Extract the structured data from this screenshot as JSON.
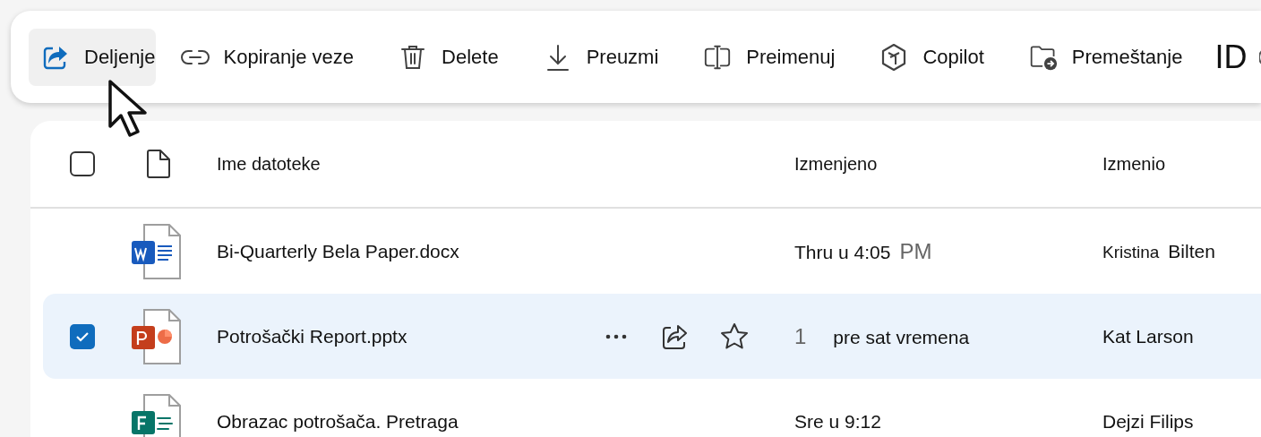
{
  "toolbar": {
    "items": [
      {
        "kind": "share",
        "label": "Deljenje",
        "hovered": true
      },
      {
        "kind": "link",
        "label": "Kopiranje veze",
        "hovered": false
      },
      {
        "kind": "delete",
        "label": "Delete",
        "hovered": false
      },
      {
        "kind": "download",
        "label": "Preuzmi",
        "hovered": false
      },
      {
        "kind": "rename",
        "label": "Preimenuj",
        "hovered": false
      },
      {
        "kind": "copilot",
        "label": "Copilot",
        "hovered": false
      },
      {
        "kind": "move",
        "label": "Premeštanje",
        "hovered": false
      }
    ],
    "overflow_label": "ID"
  },
  "table": {
    "columns": [
      "Ime datoteke",
      "Izmenjeno",
      "Izmenio"
    ],
    "all_selected": false,
    "rows": [
      {
        "kind": "word",
        "name": "Bi-Quarterly Bela Paper.docx",
        "modified": [
          {
            "text": "Thru u 4:05",
            "dim": false
          },
          {
            "text": "PM",
            "dim": true
          }
        ],
        "modified_by": [
          "Kristina",
          "Bilten"
        ],
        "selected": false,
        "hovered": false
      },
      {
        "kind": "powerpoint",
        "name": "Potrošački Report.pptx",
        "modified": [
          {
            "text": "1",
            "dim": true
          },
          {
            "text": "pre sat vremena",
            "dim": false
          }
        ],
        "modified_by": [
          "Kat Larson"
        ],
        "selected": true,
        "hovered": true
      },
      {
        "kind": "forms",
        "name": "Obrazac potrošača. Pretraga",
        "modified": [
          {
            "text": "Sre u 9:12",
            "dim": false
          }
        ],
        "modified_by": [
          "Dejzi Filips"
        ],
        "selected": false,
        "hovered": false
      }
    ]
  }
}
